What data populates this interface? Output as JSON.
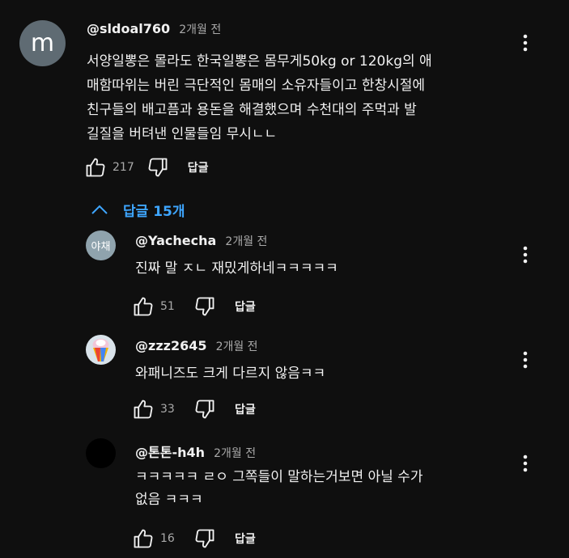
{
  "main_comment": {
    "avatar_letter": "m",
    "avatar_color": "#5f6b73",
    "author": "@sldoal760",
    "time": "2개월 전",
    "text": "서양일뽕은 몰라도 한국일뽕은 몸무게50kg or 120kg의 애\n매함따위는 버린 극단적인 몸매의 소유자들이고 한창시절에\n친구들의 배고픔과 용돈을 해결했으며 수천대의 주먹과 발\n길질을 버텨낸 인물들임 무시ㄴㄴ",
    "likes": "217",
    "reply_label": "답글"
  },
  "replies_toggle": {
    "label": "답글 15개",
    "icon": "chevron-up-icon",
    "color": "#3ea6ff"
  },
  "replies": [
    {
      "avatar_text": "야채",
      "avatar_color": "#8fa3ad",
      "author": "@Yachecha",
      "time": "2개월 전",
      "text": "진짜 말 ㅈㄴ 재밌게하네ㅋㅋㅋㅋㅋ",
      "likes": "51",
      "reply_label": "답글"
    },
    {
      "avatar_text": "",
      "avatar_color": "#d9e3ea",
      "author": "@zzz2645",
      "time": "2개월 전",
      "text": "와패니즈도 크게 다르지 않음ㅋㅋ",
      "likes": "33",
      "reply_label": "답글"
    },
    {
      "avatar_text": "",
      "avatar_color": "#000000",
      "author": "@톤톤-h4h",
      "time": "2개월 전",
      "text": "ㅋㅋㅋㅋㅋ ㄹㅇ 그쪽들이 말하는거보면 아닐 수가\n없음 ㅋㅋㅋ",
      "likes": "16",
      "reply_label": "답글"
    }
  ]
}
